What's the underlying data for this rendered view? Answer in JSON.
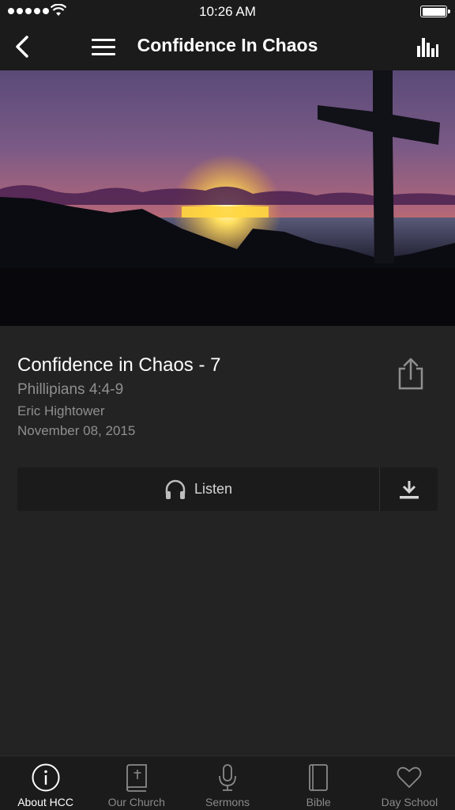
{
  "status_bar": {
    "time": "10:26 AM"
  },
  "nav": {
    "title": "Confidence In Chaos"
  },
  "sermon": {
    "title": "Confidence in Chaos - 7",
    "passage": "Phillipians 4:4-9",
    "speaker": "Eric Hightower",
    "date": "November 08, 2015"
  },
  "actions": {
    "listen_label": "Listen"
  },
  "tabs": [
    {
      "label": "About HCC",
      "icon": "info-icon",
      "active": true
    },
    {
      "label": "Our Church",
      "icon": "bible-book-icon",
      "active": false
    },
    {
      "label": "Sermons",
      "icon": "microphone-icon",
      "active": false
    },
    {
      "label": "Bible",
      "icon": "book-icon",
      "active": false
    },
    {
      "label": "Day School",
      "icon": "heart-icon",
      "active": false
    }
  ],
  "colors": {
    "background": "#232323",
    "bar": "#1b1b1b",
    "secondary_text": "#8f8f8f"
  }
}
